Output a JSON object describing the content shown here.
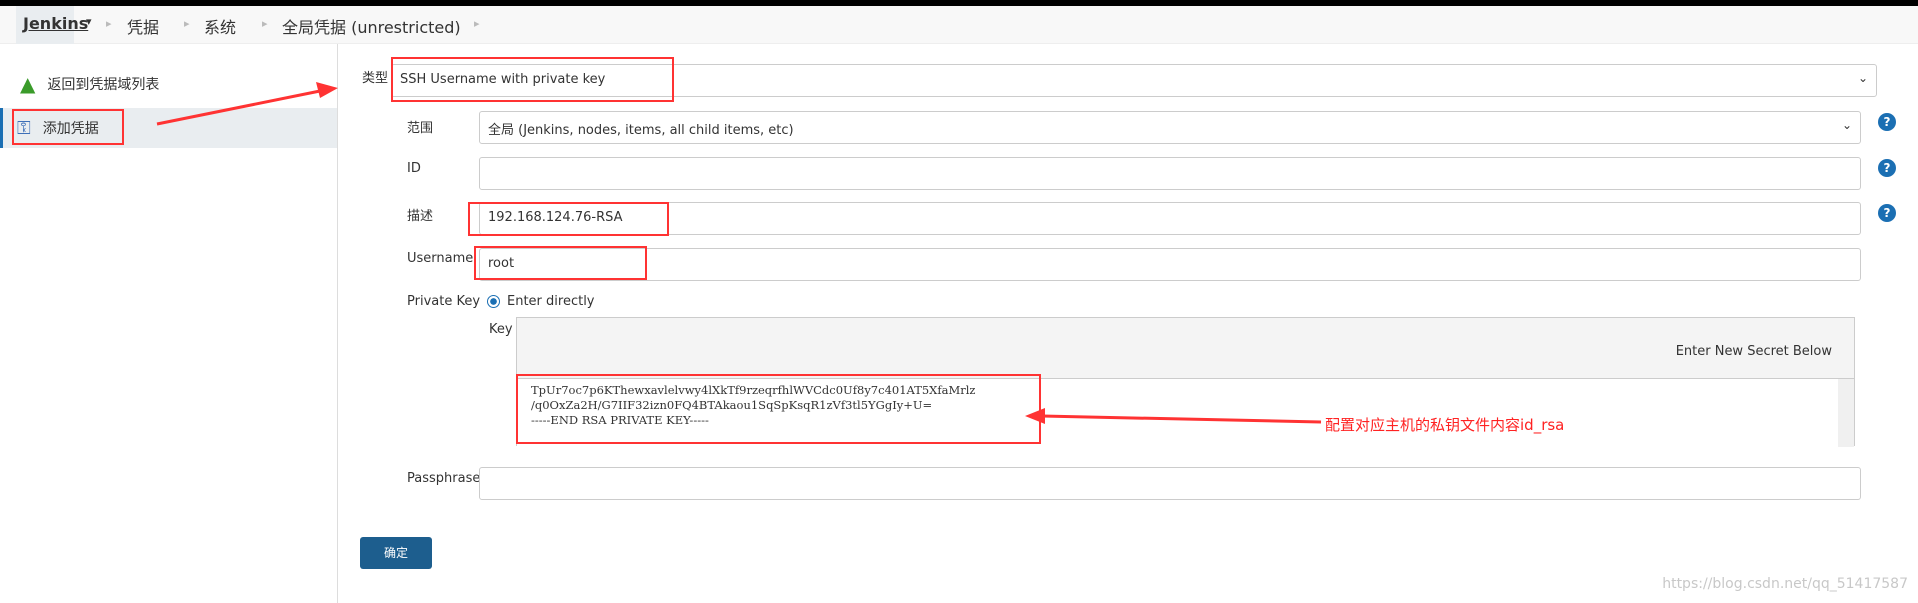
{
  "breadcrumb": [
    "Jenkins",
    "凭据",
    "系统",
    "全局凭据 (unrestricted)"
  ],
  "sidebar": {
    "items": [
      {
        "label": "返回到凭据域列表",
        "icon": "up-arrow-icon"
      },
      {
        "label": "添加凭据",
        "icon": "key-icon",
        "active": true
      }
    ]
  },
  "form": {
    "kind_label": "类型",
    "kind_value": "SSH Username with private key",
    "scope_label": "范围",
    "scope_value": "全局 (Jenkins, nodes, items, all child items, etc)",
    "id_label": "ID",
    "id_value": "",
    "desc_label": "描述",
    "desc_value": "192.168.124.76-RSA",
    "username_label": "Username",
    "username_value": "root",
    "pk_label": "Private Key",
    "pk_option": "Enter directly",
    "key_label": "Key",
    "key_hint": "Enter New Secret Below",
    "key_value": "TpUr7oc7p6KThewxavlelvwy4lXkTf9rzeqrfhlWVCdc0Uf8y7c401AT5XfaMrlz\n/q0OxZa2H/G7IIF32izn0FQ4BTAkaou1SqSpKsqR1zVf3tl5YGgIy+U=\n-----END RSA PRIVATE KEY-----",
    "passphrase_label": "Passphrase",
    "passphrase_value": "",
    "submit": "确定"
  },
  "annotation": "配置对应主机的私钥文件内容id_rsa",
  "watermark": "https://blog.csdn.net/qq_51417587",
  "colors": {
    "accent": "#1d5e8e",
    "annotation": "#ff3333",
    "help": "#1b6fb3"
  }
}
